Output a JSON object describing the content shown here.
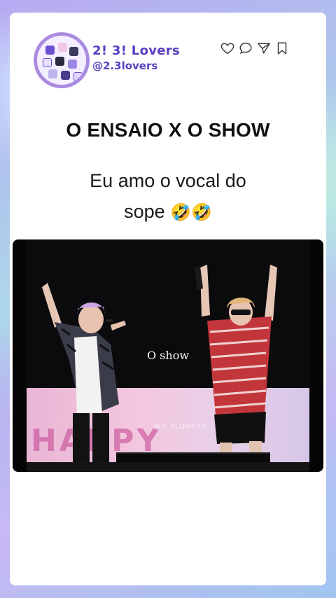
{
  "profile": {
    "name": "2! 3! Lovers",
    "handle": "@2.3lovers",
    "avatar_icon": "group-photo-avatar",
    "accent_color": "#5a3fc0"
  },
  "actions": [
    {
      "icon": "heart-icon"
    },
    {
      "icon": "comment-icon"
    },
    {
      "icon": "share-icon"
    },
    {
      "icon": "bookmark-icon"
    }
  ],
  "post": {
    "headline": "O ENSAIO X O SHOW",
    "caption_line1": "Eu amo o vocal do",
    "caption_line2": "sope",
    "caption_emoji": "🤣🤣"
  },
  "video": {
    "overlay_text": "O show",
    "watermark": "@2.3LOVERS",
    "banner_text": "HAPPY"
  }
}
